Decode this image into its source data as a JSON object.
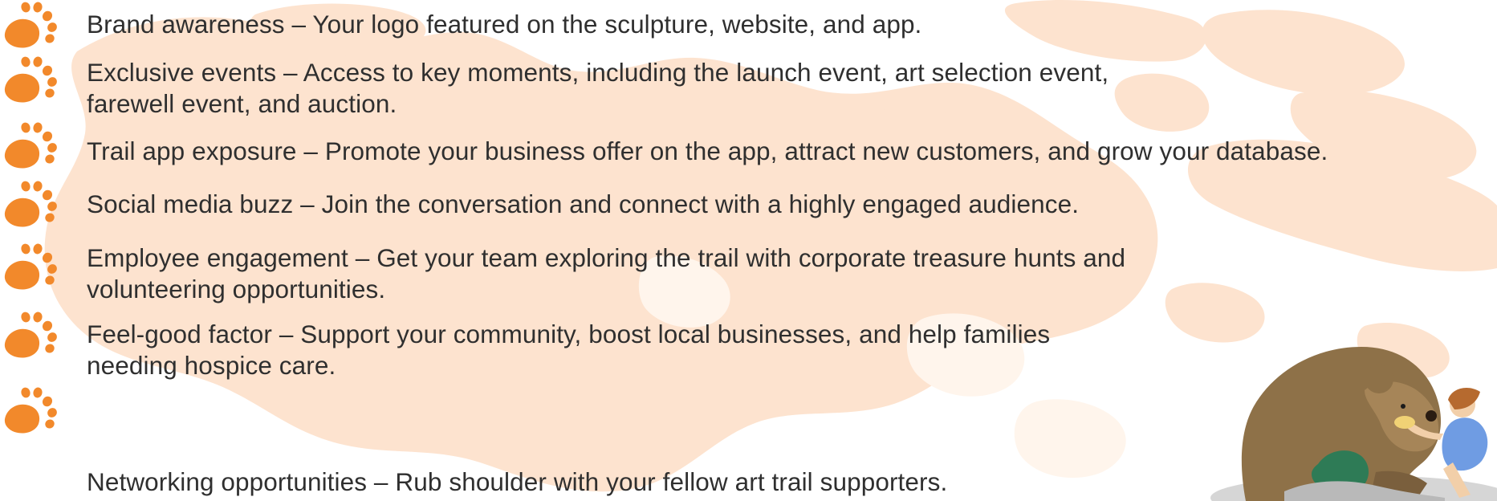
{
  "benefits": [
    {
      "text": "Brand awareness – Your logo featured on the sculpture, website, and app."
    },
    {
      "text": "Exclusive events – Access to key moments, including the launch event, art selection event, farewell event, and auction."
    },
    {
      "text": "Trail app exposure – Promote your business offer on the app, attract new customers, and grow your database."
    },
    {
      "text": "Social media buzz – Join the conversation and connect with a highly engaged audience."
    },
    {
      "text": "Employee engagement – Get your team exploring the trail with corporate treasure hunts and volunteering opportunities."
    },
    {
      "text": "Feel-good factor – Support your community, boost local businesses, and help families needing hospice care."
    },
    {
      "text": "Networking opportunities – Rub shoulder with your fellow art trail supporters."
    }
  ],
  "colors": {
    "background": "#ffffff",
    "paw": "#f2892b",
    "map": "#fde3cf",
    "text": "#2f2f2f"
  },
  "icons": {
    "bullet": "bear-paw-icon"
  }
}
